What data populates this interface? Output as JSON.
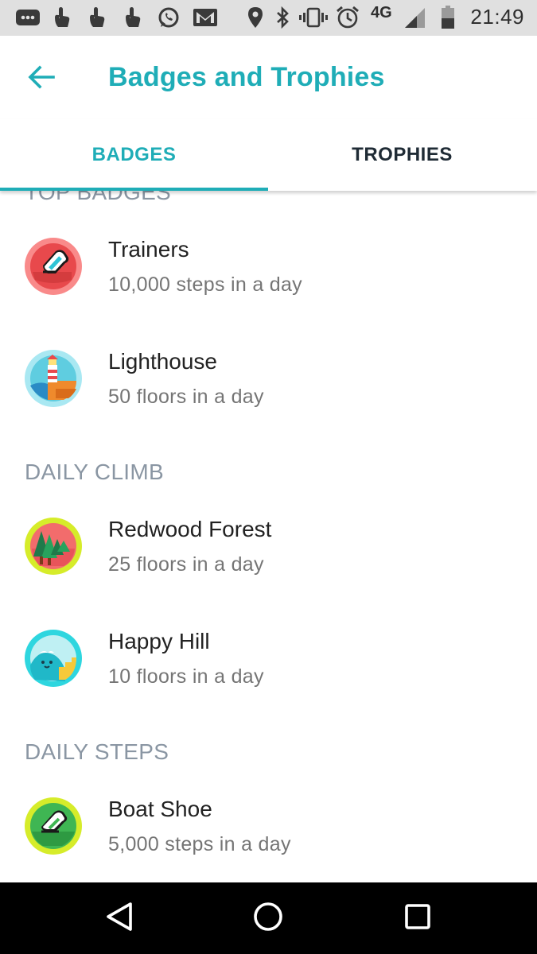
{
  "status_bar": {
    "time": "21:49",
    "network": "4G",
    "icons": [
      "messages-icon",
      "touch-icon",
      "touch-icon",
      "touch-icon",
      "whatsapp-icon",
      "gmail-icon",
      "location-icon",
      "bluetooth-icon",
      "vibrate-icon",
      "alarm-icon",
      "signal-icon",
      "battery-icon"
    ]
  },
  "app_bar": {
    "back_icon": "arrow-back-icon",
    "title": "Badges and Trophies"
  },
  "tabs": [
    {
      "label": "BADGES",
      "selected": true
    },
    {
      "label": "TROPHIES",
      "selected": false
    }
  ],
  "sections": [
    {
      "header": "TOP BADGES",
      "badges": [
        {
          "name": "Trainers",
          "description": "10,000 steps in a day",
          "icon": "trainers-shoe-icon"
        },
        {
          "name": "Lighthouse",
          "description": "50 floors in a day",
          "icon": "lighthouse-icon"
        }
      ]
    },
    {
      "header": "DAILY CLIMB",
      "badges": [
        {
          "name": "Redwood Forest",
          "description": "25 floors in a day",
          "icon": "redwood-forest-icon"
        },
        {
          "name": "Happy Hill",
          "description": "10 floors in a day",
          "icon": "happy-hill-icon"
        }
      ]
    },
    {
      "header": "DAILY STEPS",
      "badges": [
        {
          "name": "Boat Shoe",
          "description": "5,000 steps in a day",
          "icon": "boat-shoe-icon"
        }
      ]
    }
  ],
  "nav_bar": {
    "buttons": [
      "back-triangle-icon",
      "home-circle-icon",
      "recents-square-icon"
    ]
  },
  "colors": {
    "accent": "#1fadb7",
    "section_header": "#8a96a3",
    "status_bar_bg": "#e0e0e0",
    "nav_bar_bg": "#000000"
  }
}
